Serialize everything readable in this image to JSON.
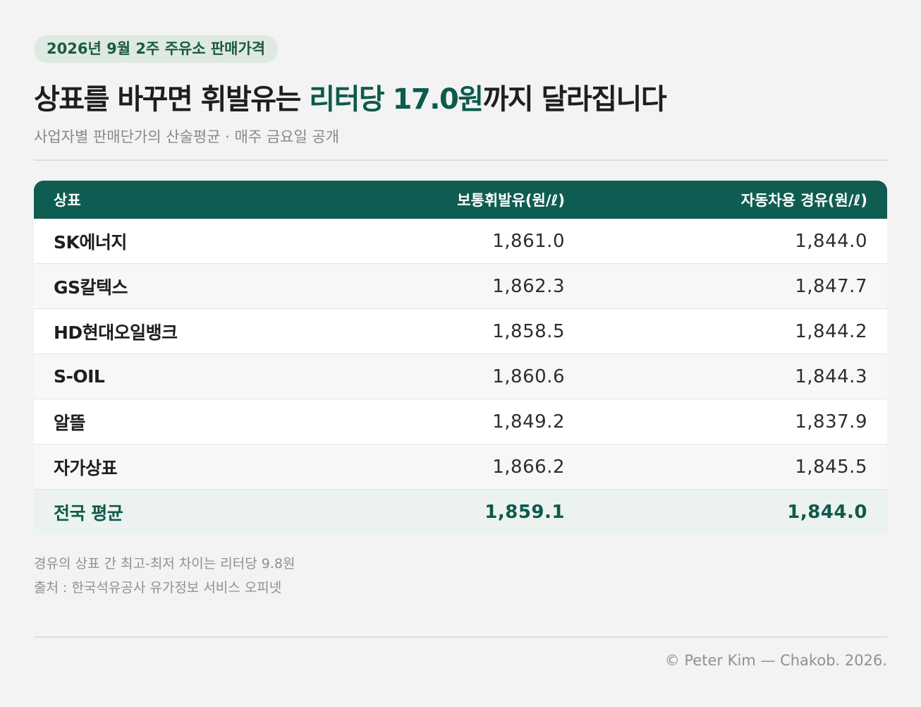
{
  "header": {
    "badge": "2026년 9월 2주 주유소 판매가격",
    "title_prefix": "상표를 바꾸면 휘발유는 ",
    "title_highlight": "리터당 17.0원",
    "title_suffix": "까지 달라집니다",
    "subtitle": "사업자별 판매단가의 산술평균 · 매주 금요일 공개"
  },
  "table": {
    "columns": [
      "상표",
      "보통휘발유(원/ℓ)",
      "자동차용 경유(원/ℓ)"
    ],
    "rows": [
      {
        "brand": "SK에너지",
        "gasoline": "1,861.0",
        "diesel": "1,844.0"
      },
      {
        "brand": "GS칼텍스",
        "gasoline": "1,862.3",
        "diesel": "1,847.7"
      },
      {
        "brand": "HD현대오일뱅크",
        "gasoline": "1,858.5",
        "diesel": "1,844.2"
      },
      {
        "brand": "S-OIL",
        "gasoline": "1,860.6",
        "diesel": "1,844.3"
      },
      {
        "brand": "알뜰",
        "gasoline": "1,849.2",
        "diesel": "1,837.9"
      },
      {
        "brand": "자가상표",
        "gasoline": "1,866.2",
        "diesel": "1,845.5"
      }
    ],
    "average": {
      "brand": "전국 평균",
      "gasoline": "1,859.1",
      "diesel": "1,844.0"
    }
  },
  "notes": {
    "line1": "경유의 상표 간 최고-최저 차이는 리터당 9.8원",
    "line2": "출처 : 한국석유공사 유가정보 서비스 오피넷"
  },
  "footer": {
    "credit": "© Peter Kim — Chakob. 2026."
  },
  "colors": {
    "accent": "#0f5c52",
    "badge_bg": "#dde9e1",
    "background": "#f2f3f2"
  }
}
